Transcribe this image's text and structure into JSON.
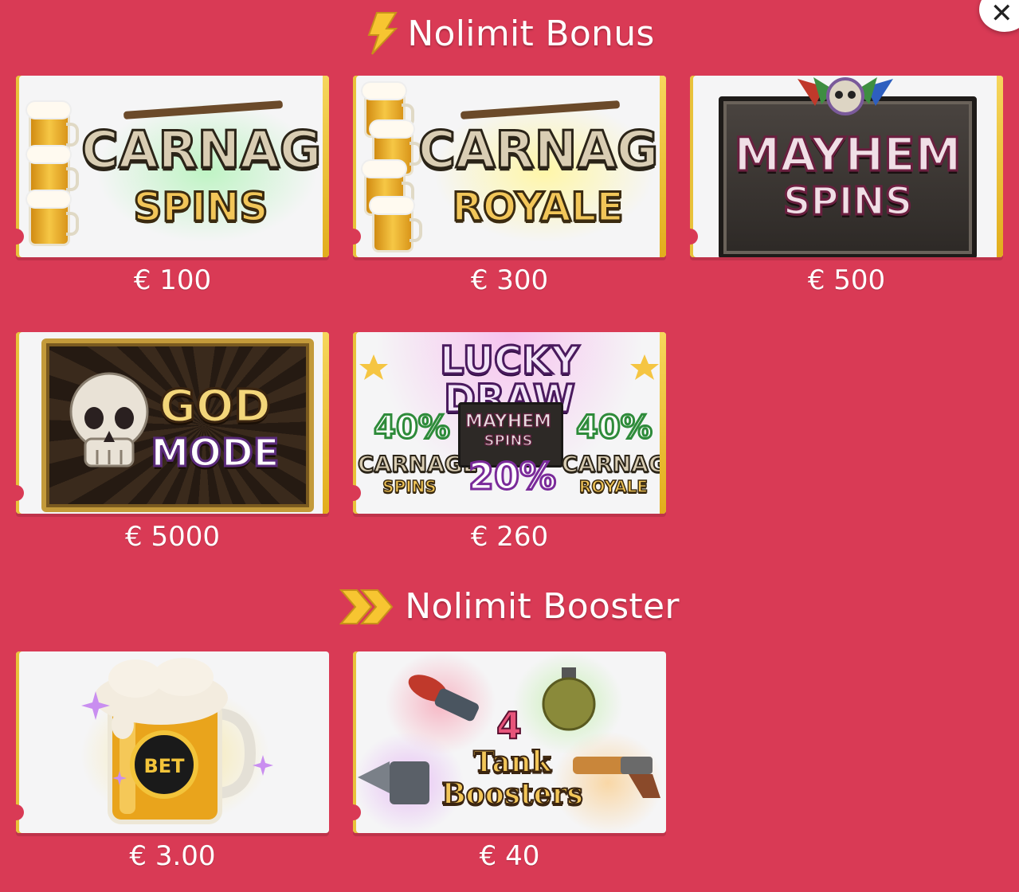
{
  "close": {
    "label": "✕"
  },
  "bonus_section": {
    "title": "Nolimit Bonus",
    "icon": "lightning-bolt-icon"
  },
  "booster_section": {
    "title": "Nolimit Booster",
    "icon": "double-chevron-icon"
  },
  "colors": {
    "background": "#d93a55",
    "accent_gold": "#f2c23a",
    "text": "#ffffff"
  },
  "bonus_items": [
    {
      "name": "Carnage Spins",
      "line1": "CARNAGE",
      "line2": "SPINS",
      "price": "€ 100"
    },
    {
      "name": "Carnage Royale",
      "line1": "CARNAGE",
      "line2": "ROYALE",
      "price": "€ 300"
    },
    {
      "name": "Mayhem Spins",
      "line1": "MAYHEM",
      "line2": "SPINS",
      "price": "€ 500"
    },
    {
      "name": "God Mode",
      "line1": "GOD",
      "line2": "MODE",
      "price": "€ 5000"
    },
    {
      "name": "Lucky Draw",
      "title": "LUCKY DRAW",
      "odds": [
        {
          "pct": "40%",
          "label1": "CARNAGE",
          "label2": "SPINS"
        },
        {
          "pct": "20%",
          "label1": "MAYHEM",
          "label2": "SPINS"
        },
        {
          "pct": "40%",
          "label1": "CARNAGE",
          "label2": "ROYALE"
        }
      ],
      "price": "€ 260"
    }
  ],
  "booster_items": [
    {
      "name": "xBet Beer",
      "badge": "BET",
      "price": "€ 3.00"
    },
    {
      "name": "Tank Boosters",
      "count": "4",
      "line1": "Tank",
      "line2": "Boosters",
      "price": "€ 40"
    }
  ]
}
